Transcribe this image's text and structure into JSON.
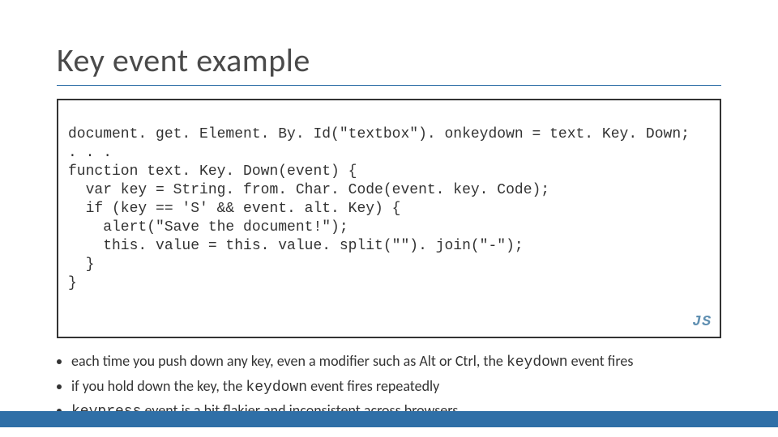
{
  "title": "Key event example",
  "code": {
    "lines": [
      "document. get. Element. By. Id(\"textbox\"). onkeydown = text. Key. Down;",
      ". . .",
      "function text. Key. Down(event) {",
      "  var key = String. from. Char. Code(event. key. Code);",
      "  if (key == 'S' && event. alt. Key) {",
      "    alert(\"Save the document!\");",
      "    this. value = this. value. split(\"\"). join(\"-\");",
      "  }",
      "}"
    ],
    "language_tag": "JS"
  },
  "bullets": [
    {
      "pre": "each time you push down any key, even a modifier such as Alt or Ctrl, the ",
      "code": "keydown",
      "post": " event fires"
    },
    {
      "pre": "if you hold down the key, the ",
      "code": "keydown",
      "post": " event fires repeatedly"
    },
    {
      "pre": "",
      "code": "keypress",
      "post": " event is a bit flakier and inconsistent across browsers"
    }
  ]
}
